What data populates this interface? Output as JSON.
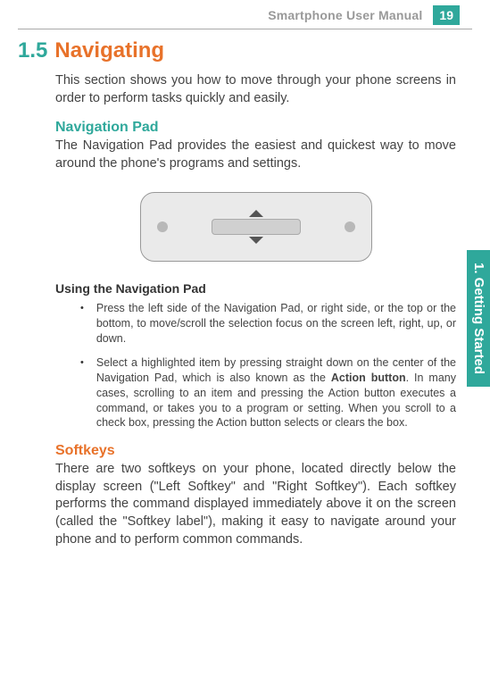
{
  "header": {
    "manual_title": "Smartphone User Manual",
    "page_number": "19"
  },
  "section": {
    "number": "1.5",
    "title": "Navigating",
    "intro": "This section shows you how to move through your phone screens in order to perform tasks quickly and easily."
  },
  "nav_pad": {
    "heading": "Navigation Pad",
    "desc": "The Navigation Pad provides the easiest and quickest way to move around the phone's programs and settings.",
    "using_heading": "Using the Navigation Pad",
    "bullets": [
      "Press the left side of the Navigation Pad, or right side, or the top or the bottom, to move/scroll the selection focus on the screen left, right, up, or down.",
      "Select a highlighted item by pressing straight down on the center of the Navigation Pad, which is also known as the |Action button|.  In many cases, scrolling to an item and pressing the Action button executes a command, or takes you to a program or setting.  When you scroll to a check box, pressing the Action button selects or clears the box."
    ]
  },
  "softkeys": {
    "heading": "Softkeys",
    "desc": "There are two softkeys on your phone, located directly below the display screen (\"Left Softkey\" and \"Right Softkey\").  Each softkey performs the command displayed immediately above it on the screen (called the \"Softkey label\"), making it easy to navigate around your phone and to perform common commands."
  },
  "side_tab": "1. Getting Started"
}
